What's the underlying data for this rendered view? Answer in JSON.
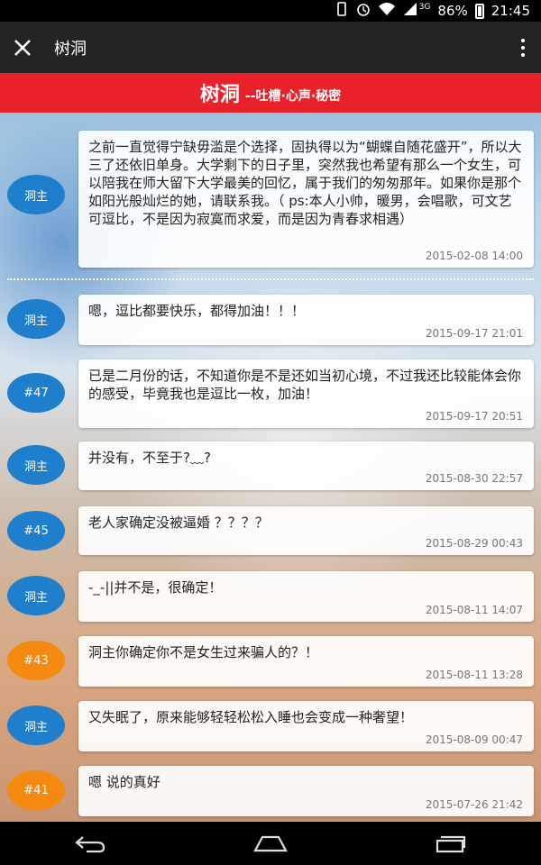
{
  "status": {
    "battery": "86%",
    "time": "21:45",
    "signal": "3G"
  },
  "appbar": {
    "title": "树洞"
  },
  "banner": {
    "title": "树洞",
    "subtitle": "--吐槽·心声·秘密"
  },
  "posts": [
    {
      "badge": "洞主",
      "text": "之前一直觉得宁缺毋滥是个选择，固执得以为“蝴蝶自随花盛开”，所以大三了还依旧单身。大学剩下的日子里，突然我也希望有那么一个女生，可以陪我在师大留下大学最美的回忆，属于我们的匆匆那年。如果你是那个如阳光般灿烂的她，请联系我。（ ps:本人小帅，暖男，会唱歌，可文艺可逗比，不是因为寂寞而求爱，而是因为青春求相遇）",
      "time": "2015-02-08 14:00"
    },
    {
      "badge": "洞主",
      "text": "嗯，逗比都要快乐，都得加油！！！",
      "time": "2015-09-17 21:01"
    },
    {
      "badge": "#47",
      "text": "已是二月份的话，不知道你是不是还如当初心境，不过我还比较能体会你的感受，毕竟我也是逗比一枚，加油！",
      "time": "2015-09-17 20:51"
    },
    {
      "badge": "洞主",
      "text": "并没有，不至于?﹏?",
      "time": "2015-08-30 22:57"
    },
    {
      "badge": "#45",
      "text": "老人家确定没被逼婚 ？？？？",
      "time": "2015-08-29 00:43"
    },
    {
      "badge": "洞主",
      "text": "-_-||并不是，很确定！",
      "time": "2015-08-11 14:07"
    },
    {
      "badge": "#43",
      "text": "洞主你确定你不是女生过来骗人的？！",
      "time": "2015-08-11 13:28"
    },
    {
      "badge": "洞主",
      "text": "又失眠了，原来能够轻轻松松入睡也会变成一种奢望！",
      "time": "2015-08-09 00:47"
    },
    {
      "badge": "#41",
      "text": "嗯 说的真好",
      "time": "2015-07-26 21:42"
    }
  ],
  "colors": {
    "banner": "#e8212a",
    "badge_owner": "#1f7fcc",
    "badge_orange": "#f58a12",
    "appbar": "#242424"
  }
}
